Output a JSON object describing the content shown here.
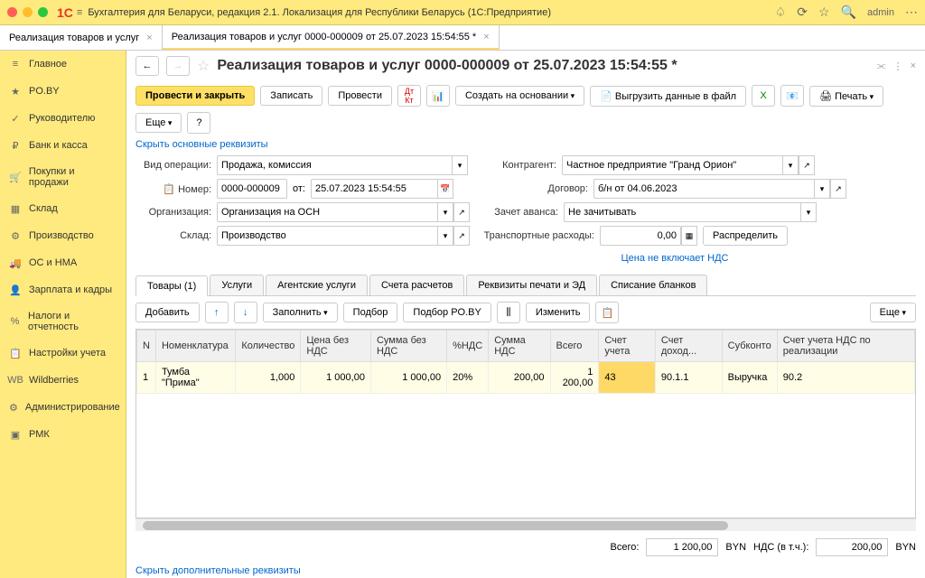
{
  "titlebar": {
    "app_title": "Бухгалтерия для Беларуси, редакция 2.1. Локализация для Республики Беларусь  (1С:Предприятие)",
    "user": "admin"
  },
  "tabs": [
    {
      "label": "Реализация товаров и услуг",
      "active": false
    },
    {
      "label": "Реализация товаров и услуг 0000-000009 от 25.07.2023 15:54:55 *",
      "active": true
    }
  ],
  "sidebar": {
    "items": [
      {
        "label": "Главное",
        "icon": "≡"
      },
      {
        "label": "PO.BY",
        "icon": "★"
      },
      {
        "label": "Руководителю",
        "icon": "✓"
      },
      {
        "label": "Банк и касса",
        "icon": "₽"
      },
      {
        "label": "Покупки и продажи",
        "icon": "🛒"
      },
      {
        "label": "Склад",
        "icon": "▦"
      },
      {
        "label": "Производство",
        "icon": "⚙"
      },
      {
        "label": "ОС и НМА",
        "icon": "🚚"
      },
      {
        "label": "Зарплата и кадры",
        "icon": "👤"
      },
      {
        "label": "Налоги и отчетность",
        "icon": "%"
      },
      {
        "label": "Настройки учета",
        "icon": "📋"
      },
      {
        "label": "Wildberries",
        "icon": "WB"
      },
      {
        "label": "Администрирование",
        "icon": "⚙"
      },
      {
        "label": "РМК",
        "icon": "▣"
      }
    ]
  },
  "document": {
    "title": "Реализация товаров и услуг 0000-000009 от 25.07.2023 15:54:55 *",
    "toolbar": {
      "post_close": "Провести и закрыть",
      "write": "Записать",
      "post": "Провести",
      "create_basis": "Создать на основании",
      "export_file": "Выгрузить данные в файл",
      "print": "Печать",
      "more": "Еще"
    },
    "hide_main": "Скрыть основные реквизиты",
    "form": {
      "operation_label": "Вид операции:",
      "operation_value": "Продажа, комиссия",
      "number_label": "Номер:",
      "number_value": "0000-000009",
      "from_label": "от:",
      "date_value": "25.07.2023 15:54:55",
      "org_label": "Организация:",
      "org_value": "Организация на ОСН",
      "warehouse_label": "Склад:",
      "warehouse_value": "Производство",
      "counterparty_label": "Контрагент:",
      "counterparty_value": "Частное предприятие \"Гранд Орион\"",
      "contract_label": "Договор:",
      "contract_value": "б/н от 04.06.2023",
      "advance_label": "Зачет аванса:",
      "advance_value": "Не зачитывать",
      "transport_label": "Транспортные расходы:",
      "transport_value": "0,00",
      "distribute_btn": "Распределить",
      "price_vat_link": "Цена не включает НДС"
    },
    "sub_tabs": [
      {
        "label": "Товары (1)",
        "active": true
      },
      {
        "label": "Услуги",
        "active": false
      },
      {
        "label": "Агентские услуги",
        "active": false
      },
      {
        "label": "Счета расчетов",
        "active": false
      },
      {
        "label": "Реквизиты печати и ЭД",
        "active": false
      },
      {
        "label": "Списание бланков",
        "active": false
      }
    ],
    "table_toolbar": {
      "add": "Добавить",
      "fill": "Заполнить",
      "pick": "Подбор",
      "pick_poby": "Подбор PO.BY",
      "change": "Изменить",
      "more": "Еще"
    },
    "table": {
      "headers": [
        "N",
        "Номенклатура",
        "Количество",
        "Цена без НДС",
        "Сумма без НДС",
        "%НДС",
        "Сумма НДС",
        "Всего",
        "Счет учета",
        "Счет доход...",
        "Субконто",
        "Счет учета НДС по реализации"
      ],
      "rows": [
        {
          "n": "1",
          "nom": "Тумба \"Прима\"",
          "qty": "1,000",
          "price": "1 000,00",
          "sum": "1 000,00",
          "vat_pct": "20%",
          "vat_sum": "200,00",
          "total": "1 200,00",
          "acct": "43",
          "income_acct": "90.1.1",
          "subconto": "Выручка",
          "vat_acct": "90.2"
        }
      ]
    },
    "footer": {
      "total_label": "Всего:",
      "total_value": "1 200,00",
      "currency": "BYN",
      "vat_incl_label": "НДС (в т.ч.):",
      "vat_value": "200,00"
    },
    "hide_extra": "Скрыть дополнительные реквизиты"
  }
}
